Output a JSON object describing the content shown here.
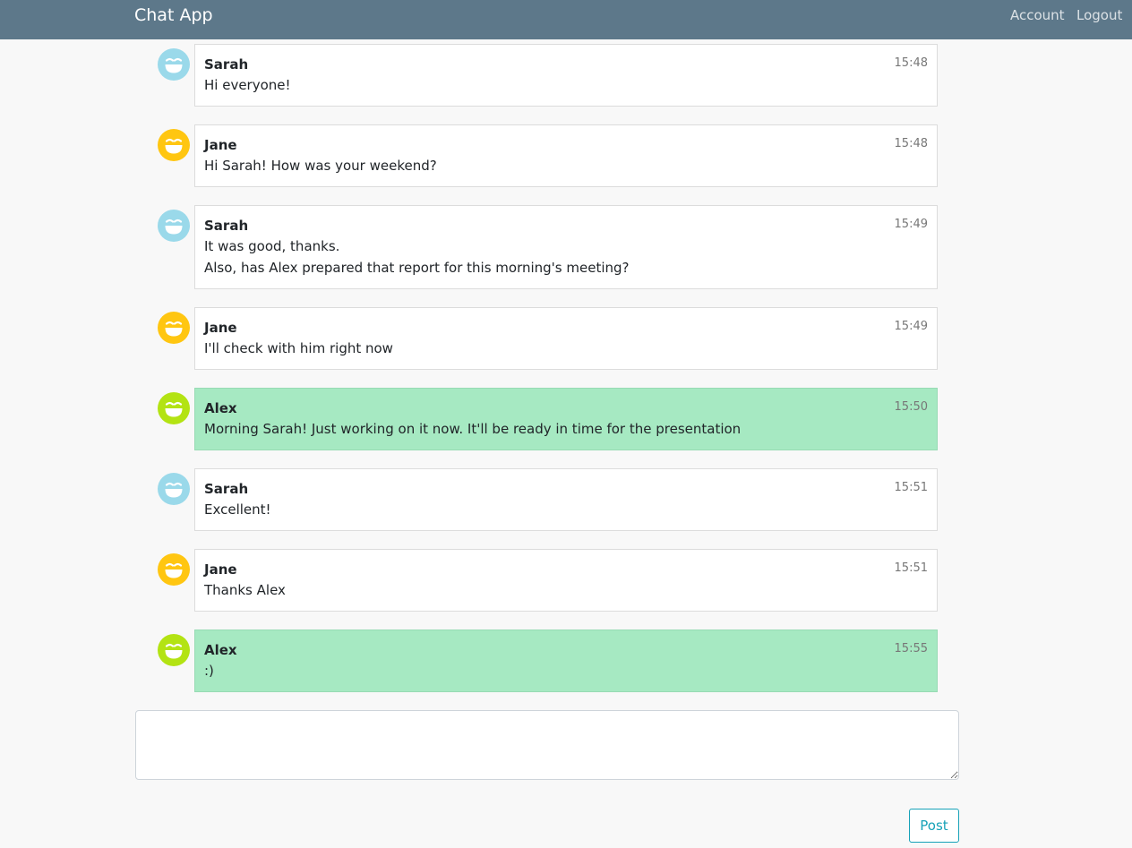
{
  "app": {
    "title": "Chat App"
  },
  "nav": {
    "account": "Account",
    "logout": "Logout"
  },
  "colors": {
    "sarah": "#9ad9ea",
    "jane": "#ffc611",
    "alex": "#b3e313",
    "own_bubble": "#a6e9c2"
  },
  "messages": [
    {
      "author": "Sarah",
      "time": "15:48",
      "avatar": "smiley-icon",
      "avatar_color": "#9ad9ea",
      "own": false,
      "lines": [
        "Hi everyone!"
      ]
    },
    {
      "author": "Jane",
      "time": "15:48",
      "avatar": "smiley-icon",
      "avatar_color": "#ffc611",
      "own": false,
      "lines": [
        "Hi Sarah! How was your weekend?"
      ]
    },
    {
      "author": "Sarah",
      "time": "15:49",
      "avatar": "smiley-icon",
      "avatar_color": "#9ad9ea",
      "own": false,
      "lines": [
        "It was good, thanks.",
        "Also, has Alex prepared that report for this morning's meeting?"
      ]
    },
    {
      "author": "Jane",
      "time": "15:49",
      "avatar": "smiley-icon",
      "avatar_color": "#ffc611",
      "own": false,
      "lines": [
        "I'll check with him right now"
      ]
    },
    {
      "author": "Alex",
      "time": "15:50",
      "avatar": "smiley-icon",
      "avatar_color": "#b3e313",
      "own": true,
      "lines": [
        "Morning Sarah! Just working on it now. It'll be ready in time for the presentation"
      ]
    },
    {
      "author": "Sarah",
      "time": "15:51",
      "avatar": "smiley-icon",
      "avatar_color": "#9ad9ea",
      "own": false,
      "lines": [
        "Excellent!"
      ]
    },
    {
      "author": "Jane",
      "time": "15:51",
      "avatar": "smiley-icon",
      "avatar_color": "#ffc611",
      "own": false,
      "lines": [
        "Thanks Alex"
      ]
    },
    {
      "author": "Alex",
      "time": "15:55",
      "avatar": "smiley-icon",
      "avatar_color": "#b3e313",
      "own": true,
      "lines": [
        ":)"
      ]
    }
  ],
  "composer": {
    "value": "",
    "placeholder": ""
  },
  "post_button": {
    "label": "Post"
  }
}
